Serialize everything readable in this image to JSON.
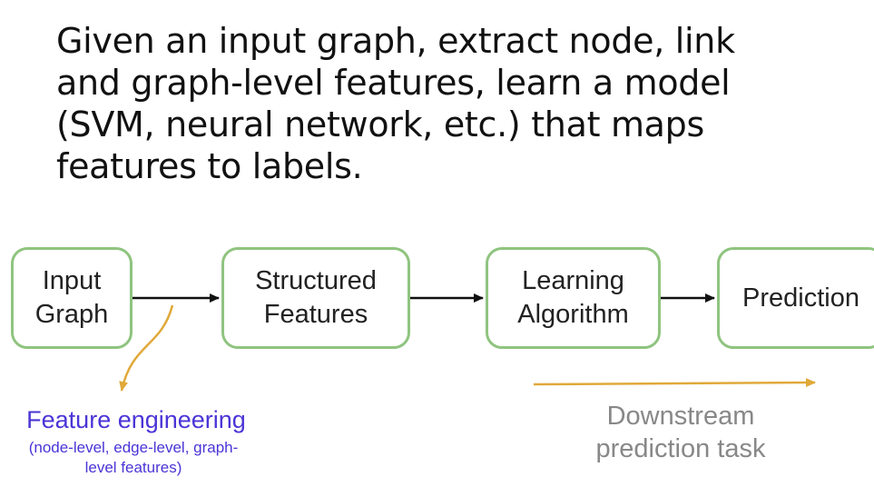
{
  "heading": {
    "lines": [
      "Given an input graph, extract node, link",
      "and graph-level features, learn a model",
      "(SVM, neural network, etc.) that maps",
      "features to labels."
    ]
  },
  "pipeline": {
    "input_graph": [
      "Input",
      "Graph"
    ],
    "structured_features": [
      "Structured",
      "Features"
    ],
    "learning_algorithm": [
      "Learning",
      "Algorithm"
    ],
    "prediction": "Prediction"
  },
  "annotations": {
    "feature_engineering": {
      "title": "Feature engineering",
      "subtitle_lines": [
        "(node-level, edge-level, graph-",
        "level features)"
      ]
    },
    "downstream": {
      "lines": [
        "Downstream",
        "prediction task"
      ]
    }
  },
  "colors": {
    "box_border": "#8fc47f",
    "flow_arrow": "#111111",
    "annotation_arrow": "#e0a93a",
    "feature_text": "#4a35d6",
    "downstream_text": "#888888"
  }
}
